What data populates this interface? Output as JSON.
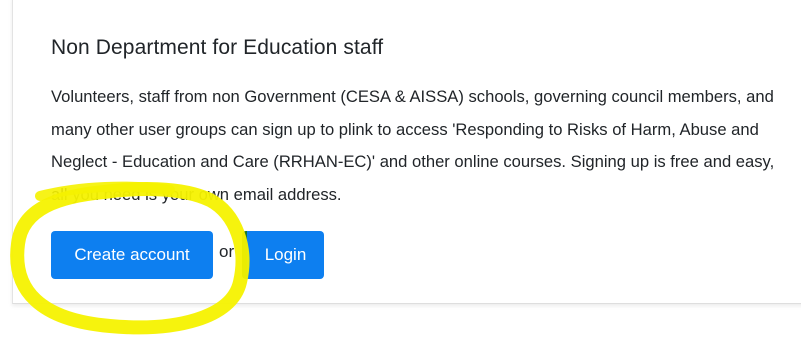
{
  "section": {
    "title": "Non Department for Education staff",
    "body": "Volunteers, staff from non Government (CESA & AISSA) schools, governing council members, and many other user groups can sign up to plink to access 'Responding to Risks of Harm, Abuse and Neglect - Education and Care (RRHAN-EC)' and other online courses. Signing up is free and easy, all you need is your own email address."
  },
  "actions": {
    "create_label": "Create account",
    "separator": "or",
    "login_label": "Login"
  },
  "colors": {
    "button_primary": "#0d7ff0",
    "text": "#212529",
    "highlight": "#f5f200",
    "login_accent": "#1a7a2a"
  }
}
